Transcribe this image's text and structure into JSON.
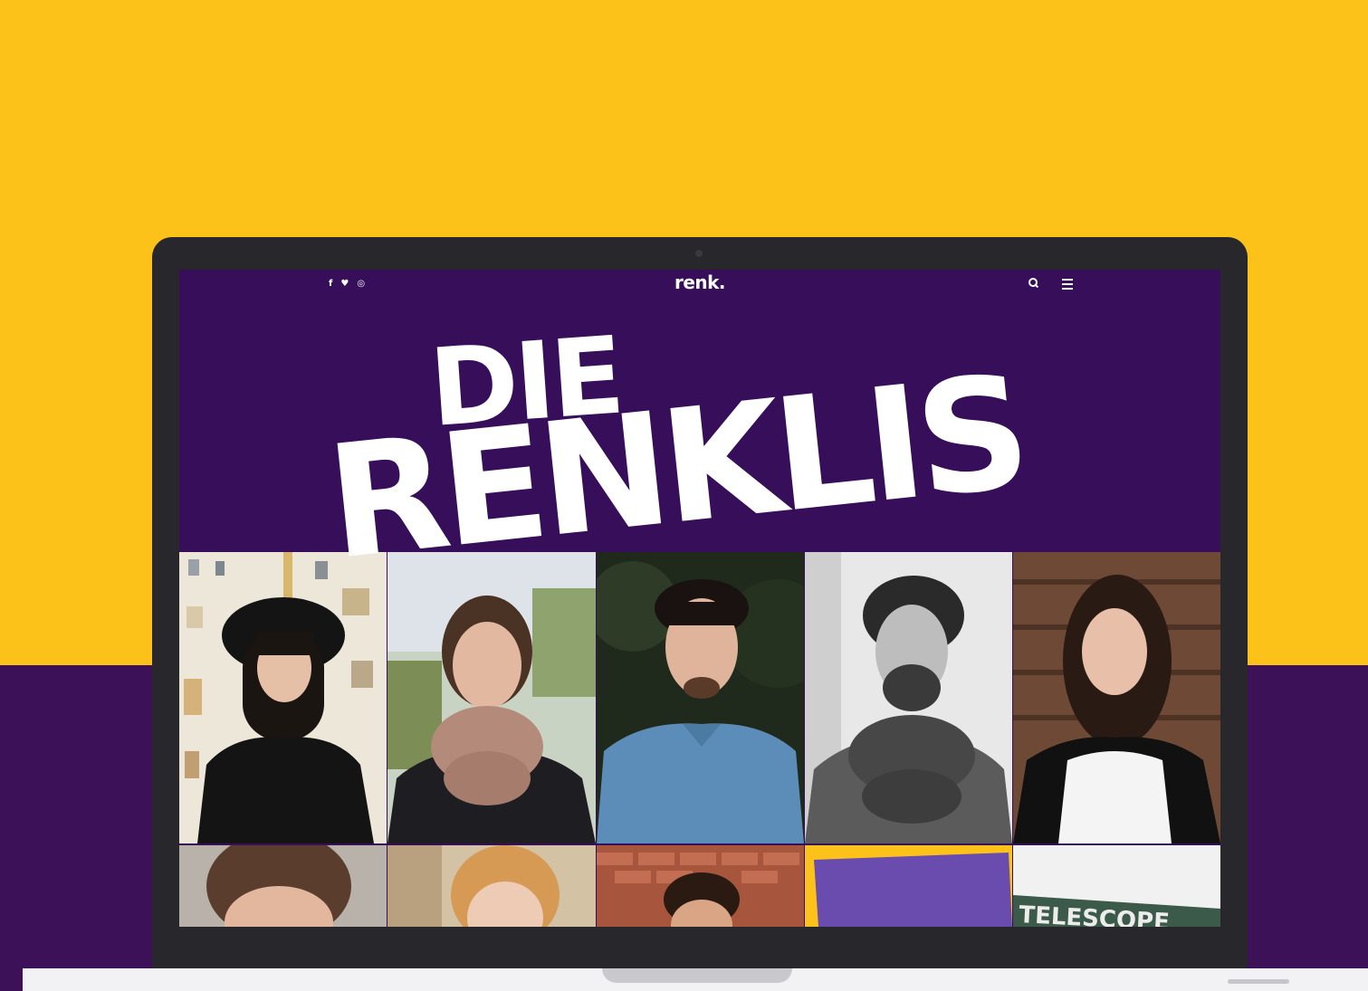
{
  "site": {
    "logo": "renk.",
    "social_icons": [
      {
        "name": "facebook-icon",
        "glyph": "f"
      },
      {
        "name": "twitter-icon",
        "glyph": "♥"
      },
      {
        "name": "instagram-icon",
        "glyph": "◎"
      }
    ],
    "nav_icons": [
      "search-icon",
      "menu-icon"
    ]
  },
  "hero": {
    "line1": "DIE",
    "line2": "RENKLIS"
  },
  "colors": {
    "background_yellow": "#FDC219",
    "background_purple": "#3D1158",
    "screen_purple": "#370E5A",
    "laptop_frame": "#28272C"
  },
  "photos": {
    "row1": [
      "person-woman-black-hat",
      "person-woman-pink-scarf",
      "person-man-denim-shirt",
      "person-man-grey-scarf-bw",
      "person-woman-dark-hair"
    ],
    "row2": [
      "person-man-quiff",
      "person-woman-blonde",
      "person-man-brick-wall",
      "purple-yellow-tile",
      "sign-telescope"
    ]
  },
  "sign_text": "TELESCOPE"
}
